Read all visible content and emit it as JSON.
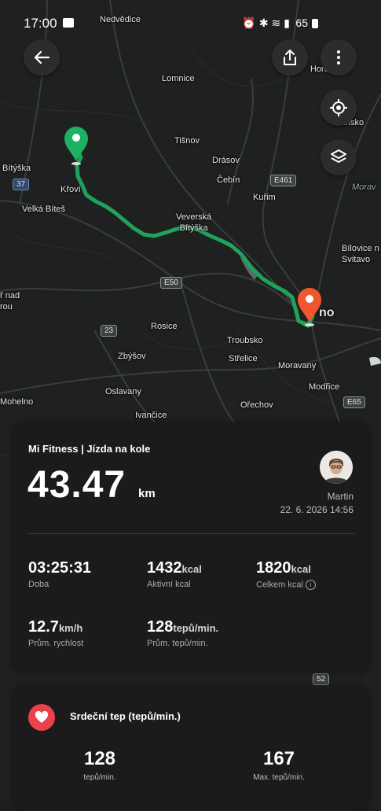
{
  "status_bar": {
    "time": "17:00",
    "battery": "65"
  },
  "map": {
    "labels": {
      "nedvedice": "Nedvědice",
      "lomnice": "Lomnice",
      "tisnov": "Tišnov",
      "drasov": "Drásov",
      "cebin": "Čebín",
      "kurim": "Kuřim",
      "bityska": "Bítýška",
      "krovi": "Křoví",
      "velka_bites": "Velká Bíteš",
      "veverska_bityska": "Veverská\nBítýška",
      "rosice": "Rosice",
      "zbysov": "Zbýšov",
      "oslavany": "Oslavany",
      "ivancice": "Ivančice",
      "mohelno": "Mohelno",
      "troubsko": "Troubsko",
      "strelice": "Střelice",
      "moravany": "Moravany",
      "modrice": "Modřice",
      "orechov": "Ořechov",
      "brno": "no",
      "blansko": "Blansko",
      "bilovice": "Bílovice n\nSvitavo",
      "morava": "Morav",
      "nad": "ř nad\nrou",
      "hora": "Hora",
      "sakce": "sice"
    },
    "shields": {
      "r37": "37",
      "e461": "E461",
      "e50": "E50",
      "r23": "23",
      "e65": "E65",
      "r52": "52"
    },
    "colors": {
      "route": "#1fa35a",
      "start_pin": "#1fb163",
      "end_pin": "#f0572e"
    }
  },
  "activity": {
    "title": "Mi Fitness | Jízda na kole",
    "distance": "43.47",
    "distance_unit": "km",
    "user": "Martin",
    "date": "22. 6. 2026 14:56",
    "stats": [
      {
        "value": "03:25:31",
        "unit": "",
        "label": "Doba"
      },
      {
        "value": "1432",
        "unit": "kcal",
        "label": "Aktivní kcal"
      },
      {
        "value": "1820",
        "unit": "kcal",
        "label": "Celkem kcal"
      },
      {
        "value": "12.7",
        "unit": "km/h",
        "label": "Prům. rychlost"
      },
      {
        "value": "128",
        "unit": "tepů/min.",
        "label": "Prům. tepů/min."
      }
    ]
  },
  "heart_rate": {
    "title": "Srdeční tep (tepů/min.)",
    "avg_value": "128",
    "avg_label": "tepů/min.",
    "max_value": "167",
    "max_label": "Max. tepů/min."
  }
}
